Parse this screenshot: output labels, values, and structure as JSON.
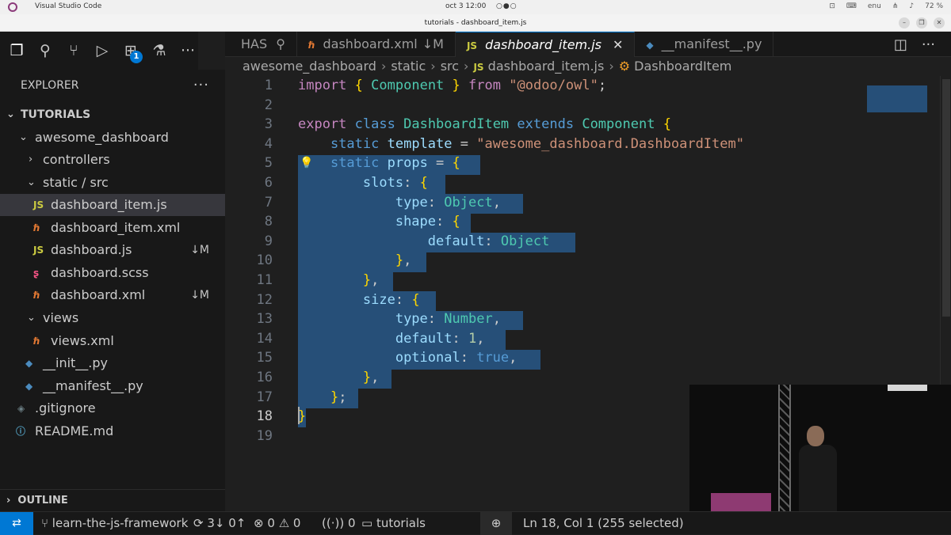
{
  "os": {
    "app_name": "Visual Studio Code",
    "clock": "oct 3   12:00",
    "lang": "enu",
    "battery": "72 %"
  },
  "window": {
    "title": "tutorials - dashboard_item.js"
  },
  "activity_bar": {
    "extensions_badge": "1"
  },
  "sidebar": {
    "header": "EXPLORER",
    "more": "···",
    "root": "TUTORIALS",
    "items": [
      {
        "label": "awesome_dashboard",
        "status": ""
      },
      {
        "label": "controllers",
        "status": ""
      },
      {
        "label": "static / src",
        "status": ""
      },
      {
        "label": "dashboard_item.js",
        "status": ""
      },
      {
        "label": "dashboard_item.xml",
        "status": ""
      },
      {
        "label": "dashboard.js",
        "status": "↓M"
      },
      {
        "label": "dashboard.scss",
        "status": ""
      },
      {
        "label": "dashboard.xml",
        "status": "↓M"
      },
      {
        "label": "views",
        "status": ""
      },
      {
        "label": "views.xml",
        "status": ""
      },
      {
        "label": "__init__.py",
        "status": ""
      },
      {
        "label": "__manifest__.py",
        "status": ""
      },
      {
        "label": ".gitignore",
        "status": ""
      },
      {
        "label": "README.md",
        "status": ""
      }
    ],
    "outline": "OUTLINE"
  },
  "tabs": [
    {
      "label": "HAS",
      "status": ""
    },
    {
      "label": "dashboard.xml",
      "status": "↓M"
    },
    {
      "label": "dashboard_item.js",
      "status": ""
    },
    {
      "label": "__manifest__.py",
      "status": ""
    }
  ],
  "breadcrumb": [
    "awesome_dashboard",
    "static",
    "src",
    "dashboard_item.js",
    "DashboardItem"
  ],
  "editor": {
    "line_numbers": [
      "1",
      "2",
      "3",
      "4",
      "5",
      "6",
      "7",
      "8",
      "9",
      "10",
      "11",
      "12",
      "13",
      "14",
      "15",
      "16",
      "17",
      "18",
      "19"
    ],
    "lines": [
      "import { Component } from \"@odoo/owl\";",
      "",
      "export class DashboardItem extends Component {",
      "    static template = \"awesome_dashboard.DashboardItem\"",
      "    static props = {",
      "        slots: {",
      "            type: Object,",
      "            shape: {",
      "                default: Object",
      "            },",
      "        },",
      "        size: {",
      "            type: Number,",
      "            default: 1,",
      "            optional: true,",
      "        },",
      "    };",
      "}",
      ""
    ]
  },
  "statusbar": {
    "branch": "learn-the-js-framework",
    "sync": "3↓ 0↑",
    "errors": "0",
    "warnings": "0",
    "ports": "0",
    "folder": "tutorials",
    "position": "Ln 18, Col 1 (255 selected)"
  }
}
